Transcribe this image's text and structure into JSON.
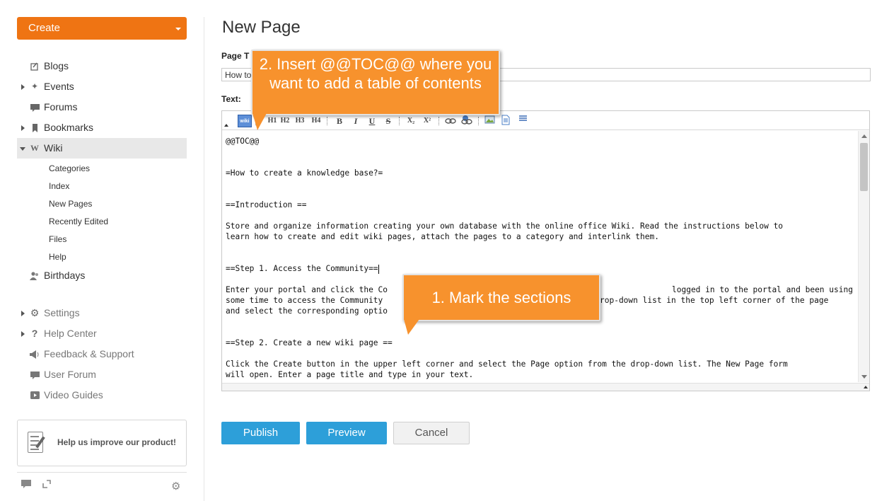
{
  "sidebar": {
    "create_label": "Create",
    "items": [
      {
        "label": "Blogs",
        "icon": "blog-icon"
      },
      {
        "label": "Events",
        "icon": "events-icon"
      },
      {
        "label": "Forums",
        "icon": "forums-icon"
      },
      {
        "label": "Bookmarks",
        "icon": "bookmark-icon"
      },
      {
        "label": "Wiki",
        "icon": "wiki-icon"
      },
      {
        "label": "Birthdays",
        "icon": "birthdays-icon"
      },
      {
        "label": "Settings",
        "icon": "gear-icon"
      },
      {
        "label": "Help Center",
        "icon": "question-icon"
      },
      {
        "label": "Feedback & Support",
        "icon": "megaphone-icon"
      },
      {
        "label": "User Forum",
        "icon": "chat-icon"
      },
      {
        "label": "Video Guides",
        "icon": "play-icon"
      }
    ],
    "wiki_sub": [
      "Categories",
      "Index",
      "New Pages",
      "Recently Edited",
      "Files",
      "Help"
    ],
    "improve_text": "Help us improve our product!",
    "wiki_glyph": "W"
  },
  "main": {
    "title": "New Page",
    "page_title_label": "Page T",
    "page_title_value": "How to",
    "text_label": "Text:",
    "toolbar": [
      "wiki",
      "H1",
      "H2",
      "H3",
      "H4",
      "B",
      "I",
      "U",
      "S",
      "X₂",
      "X²"
    ],
    "editor_lines": [
      "@@TOC@@",
      "=How to create a knowledge base?=",
      "==Introduction ==",
      "Store and organize information creating your own database with the online office Wiki. Read the instructions below to",
      "learn how to create and edit wiki pages, attach the pages to a category and interlink them.",
      "==Step 1. Access the Community==",
      "Enter your portal and click the Co",
      "logged in to the portal and been using it for",
      "some time to access the Community",
      "rop-down list in the top left corner of the page",
      "and select the corresponding optio",
      "==Step 2. Create a new wiki page ==",
      "Click the Create button in the upper left corner and select the Page option from the drop-down list. The New Page form",
      "will open. Enter a page title and type in your text."
    ],
    "buttons": {
      "publish": "Publish",
      "preview": "Preview",
      "cancel": "Cancel"
    }
  },
  "callouts": {
    "insert_toc": "2. Insert @@TOC@@ where you want to add a table of contents",
    "mark_sections": "1. Mark the sections"
  },
  "colors": {
    "accent": "#ef7413",
    "primary": "#2d9fd9",
    "callout": "#f7922d"
  }
}
